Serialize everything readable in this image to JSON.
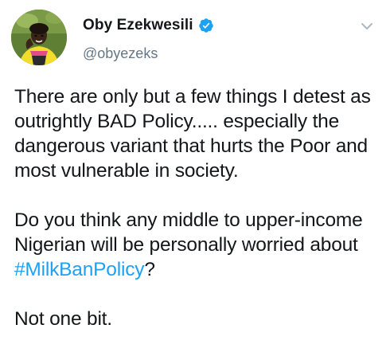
{
  "author": {
    "display_name": "Oby Ezekwesili",
    "handle": "@obyezeks",
    "verified": true
  },
  "tweet": {
    "paragraph_1": "There are only but a few things I detest as outrightly BAD Policy..... especially the dangerous variant that hurts the Poor and most vulnerable in society.",
    "paragraph_2_before": "Do you think any middle to upper-income Nigerian will be personally worried about ",
    "hashtag": "#MilkBanPolicy",
    "paragraph_2_after": "?",
    "paragraph_3": "Not one bit."
  },
  "icons": {
    "verified": "verified-badge-icon",
    "menu": "chevron-down-icon"
  },
  "colors": {
    "link": "#1da1f2",
    "secondary_text": "#657786",
    "primary_text": "#14171a"
  }
}
